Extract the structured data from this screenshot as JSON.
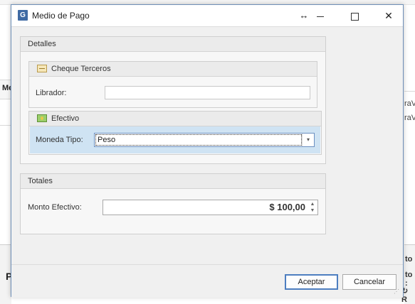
{
  "background": {
    "left_header_text": "Me",
    "left_bottom_text": "P",
    "right_text_1": "raV",
    "right_text_2": "raV",
    "right_bottom_1": "to",
    "right_bottom_2": "to :",
    "right_bottom_3": "↻ R"
  },
  "window": {
    "icon_letter": "G",
    "title": "Medio de Pago",
    "resize_glyph": "↔",
    "close_glyph": "✕"
  },
  "detalles": {
    "header": "Detalles",
    "cheque": {
      "header": "Cheque Terceros",
      "icon": "cheque-icon",
      "librador_label": "Librador:",
      "librador_value": ""
    },
    "efectivo": {
      "header": "Efectivo",
      "icon": "money-icon",
      "moneda_label": "Moneda Tipo:",
      "moneda_value": "Peso",
      "dropdown_glyph": "▾"
    }
  },
  "totales": {
    "header": "Totales",
    "monto_label": "Monto Efectivo:",
    "monto_value": "$ 100,00",
    "spin_up": "▲",
    "spin_down": "▼"
  },
  "buttons": {
    "ok": "Aceptar",
    "cancel": "Cancelar"
  },
  "colors": {
    "accent": "#4d7ec0",
    "selection_row": "#cfe3f3",
    "window_border": "#6e8fb8"
  }
}
